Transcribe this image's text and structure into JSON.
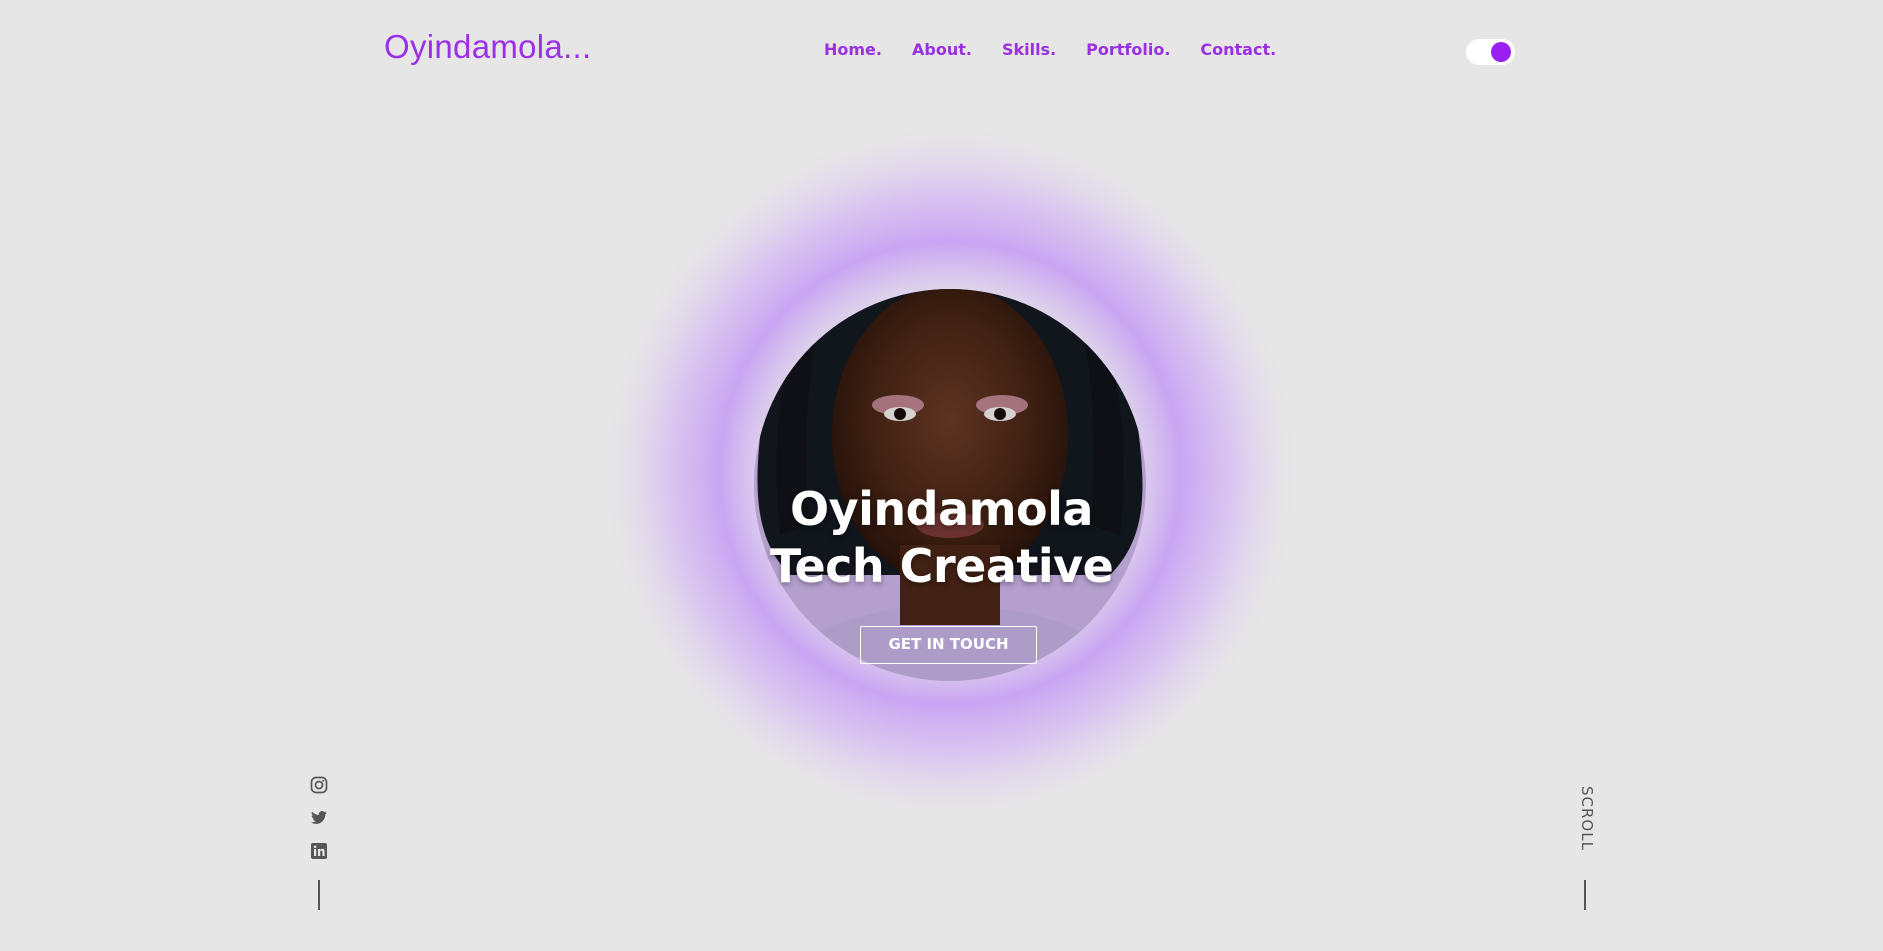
{
  "header": {
    "logo": "Oyindamola...",
    "nav": [
      {
        "label": "Home."
      },
      {
        "label": "About."
      },
      {
        "label": "Skills."
      },
      {
        "label": "Portfolio."
      },
      {
        "label": "Contact."
      }
    ],
    "theme_toggle_on": true
  },
  "hero": {
    "title_line1": "Oyindamola",
    "title_line2": "Tech Creative",
    "cta_label": "GET IN TOUCH",
    "portrait_icon": "portrait-photo"
  },
  "social": {
    "items": [
      {
        "icon": "instagram-icon"
      },
      {
        "icon": "twitter-icon"
      },
      {
        "icon": "linkedin-icon"
      }
    ]
  },
  "scroll_label": "SCROLL",
  "colors": {
    "background": "#e6e6e6",
    "accent": "#9b30e6",
    "splash": "#c49bf5",
    "icon": "#555555",
    "text_on_hero": "#ffffff"
  }
}
